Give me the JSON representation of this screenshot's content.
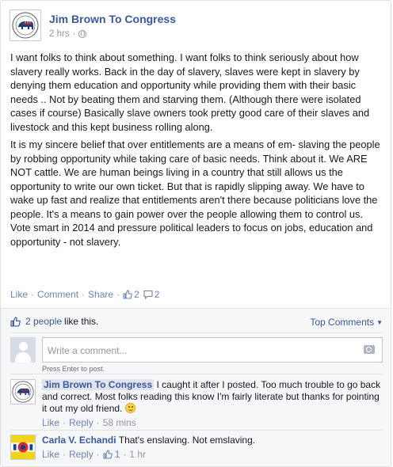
{
  "post": {
    "page_name": "Jim Brown To Congress",
    "time": "2 hrs",
    "privacy_icon": "globe-icon",
    "paragraphs": [
      "I want folks to think about something. I want folks to think seriously about how slavery really works. Back in the day of slavery, slaves were kept in slavery by denying them education and opportunity while providing them with their basic needs .. Not by beating them and starving them. (Although there were isolated cases if course) Basically slave owners took pretty good care of their slaves and livestock and this kept business rolling along.",
      "It is my sincere belief that over entitlements are a means of em- slaving the people by robbing opportunity while taking care of basic needs. Think about it. We ARE NOT cattle. We are human beings living in a country that still allows us the opportunity to write our own ticket. But that is rapidly slipping away. We have to wake up fast and realize that entitlements aren't there because politicians love the people. It's a means to gain power over the people allowing them to control us. Vote smart in 2014 and pressure political leaders to focus on jobs, education and opportunity - not slavery."
    ],
    "actions": {
      "like": "Like",
      "comment": "Comment",
      "share": "Share",
      "like_count": "2",
      "comment_count": "2"
    }
  },
  "feedback": {
    "likes_link": "2 people",
    "likes_suffix": "like this.",
    "top_comments": "Top Comments",
    "compose_placeholder": "Write a comment...",
    "compose_hint": "Press Enter to post."
  },
  "comments": [
    {
      "author": "Jim Brown To Congress",
      "text": "I caught it after I posted. Too much trouble to go back and correct. Most folks reading this know I'm fairly literate but thanks for pointing it out my old friend.",
      "like": "Like",
      "reply": "Reply",
      "time": "58 mins"
    },
    {
      "author": "Carla V. Echandi",
      "text": "That's enslaving. Not emslaving.",
      "like": "Like",
      "reply": "Reply",
      "like_count": "1",
      "time": "1 hr"
    }
  ],
  "colors": {
    "link": "#3b5998",
    "action": "#6d84b4",
    "muted": "#9197a3",
    "feedback_bg": "#f6f7f8"
  }
}
